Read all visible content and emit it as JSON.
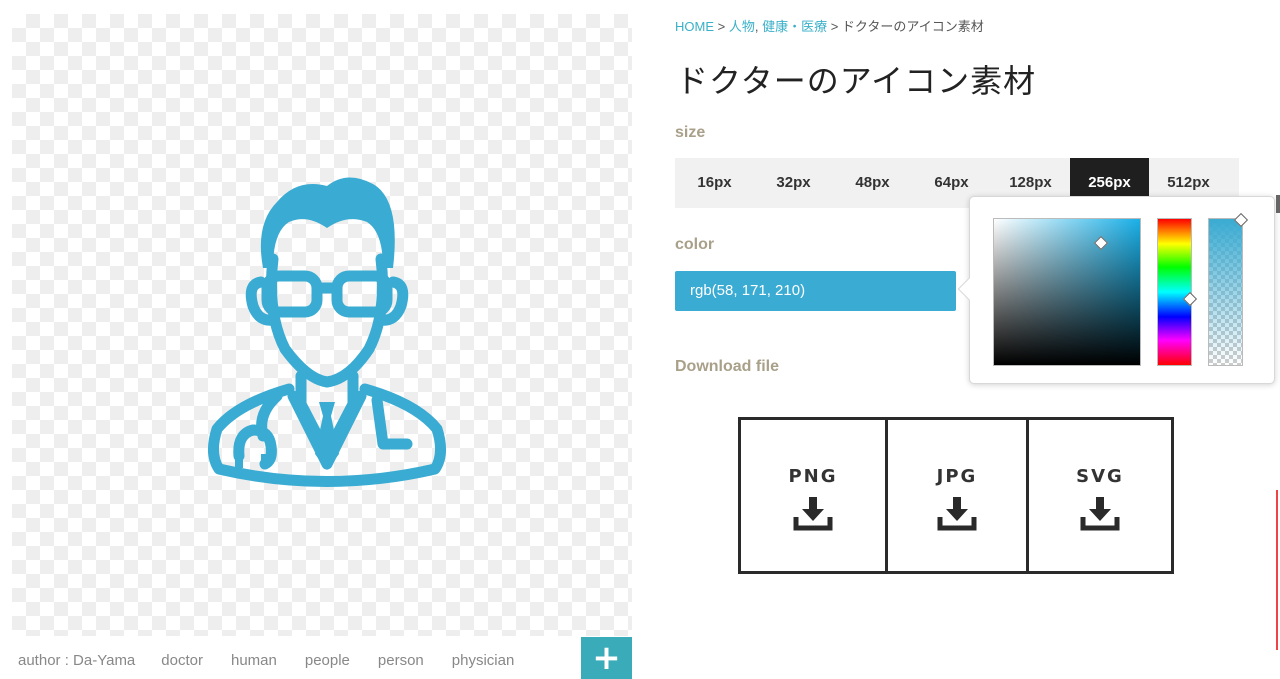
{
  "breadcrumb": {
    "home": "HOME",
    "sep1": " > ",
    "cat1": "人物",
    "comma": ", ",
    "cat2": "健康・医療",
    "sep2": " > ",
    "current": "ドクターのアイコン素材"
  },
  "title": "ドクターのアイコン素材",
  "size": {
    "label": "size",
    "options": [
      "16px",
      "32px",
      "48px",
      "64px",
      "128px",
      "256px",
      "512px"
    ],
    "selected": "256px"
  },
  "color": {
    "label": "color",
    "value": "rgb(58, 171, 210)",
    "hex": "#3aabd2"
  },
  "download": {
    "label": "Download file",
    "formats": [
      "PNG",
      "JPG",
      "SVG"
    ]
  },
  "tags": {
    "author": "author : Da-Yama",
    "items": [
      "doctor",
      "human",
      "people",
      "person",
      "physician"
    ]
  },
  "icons": {
    "plus": "+",
    "download": "download-icon"
  }
}
